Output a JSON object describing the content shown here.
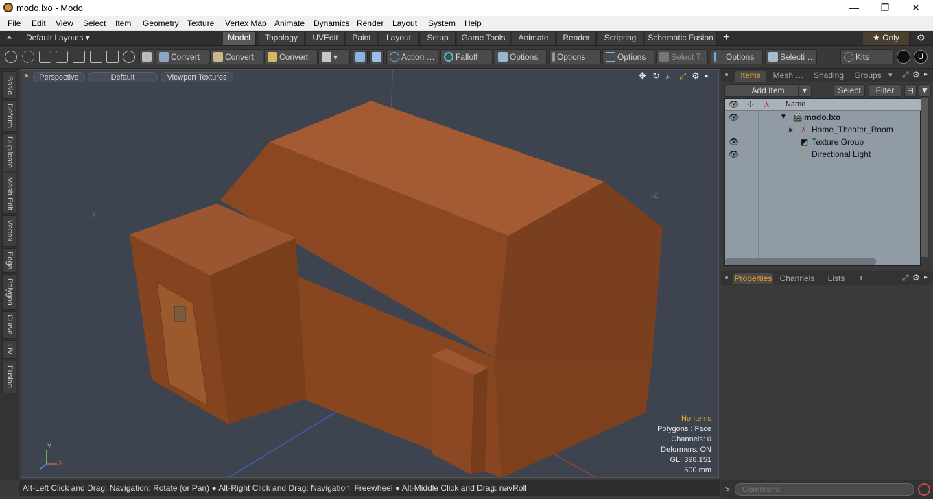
{
  "window": {
    "title": "modo.lxo - Modo",
    "minimize": "—",
    "maximize": "❐",
    "close": "✕"
  },
  "menu": [
    "File",
    "Edit",
    "View",
    "Select",
    "Item",
    "Geometry",
    "Texture",
    "Vertex Map",
    "Animate",
    "Dynamics",
    "Render",
    "Layout",
    "System",
    "Help"
  ],
  "layouts": {
    "label": "Default Layouts ▾"
  },
  "tabs": [
    "Model",
    "Topology",
    "UVEdit",
    "Paint",
    "Layout",
    "Setup",
    "Game Tools",
    "Animate",
    "Render",
    "Scripting",
    "Schematic Fusion"
  ],
  "tabs_extra": {
    "add": "+",
    "only": "★  Only",
    "gear": "⚙"
  },
  "toolbar": {
    "convert1": "Convert",
    "convert2": "Convert",
    "convert3": "Convert",
    "action": "Action  …",
    "falloff": "Falloff",
    "options1": "Options",
    "options2": "Options",
    "options3": "Options",
    "select_t": "Select T…",
    "options4": "Options",
    "selecti": "Selecti …",
    "kits": "Kits"
  },
  "left_tabs": [
    "Basic",
    "Deform",
    "Duplicate",
    "Mesh Edit",
    "Vertex",
    "Edge",
    "Polygon",
    "Curve",
    "UV",
    "Fusion"
  ],
  "viewport": {
    "perspective": "Perspective",
    "default": "Default",
    "textures": "Viewport Textures",
    "axis_x": "X",
    "axis_z": "-Z",
    "axis_y": "Y",
    "axis_x2": "X",
    "stats": {
      "no_items": "No Items",
      "polygons": "Polygons : Face",
      "channels": "Channels: 0",
      "deformers": "Deformers: ON",
      "gl": "GL: 398,151",
      "size": "500 mm"
    }
  },
  "status": "Alt-Left Click and Drag: Navigation: Rotate (or Pan) ● Alt-Right Click and Drag: Navigation: Freewheel ● Alt-Middle Click and Drag: navRoll",
  "items_panel": {
    "tabs": [
      "Items",
      "Mesh …",
      "Shading",
      "Groups"
    ],
    "add_item": "Add Item",
    "select": "Select",
    "filter": "Filter",
    "col_name": "Name",
    "rows": [
      {
        "name": "modo.lxo"
      },
      {
        "name": "Home_Theater_Room"
      },
      {
        "name": "Texture Group"
      },
      {
        "name": "Directional Light"
      }
    ]
  },
  "props_panel": {
    "tabs": [
      "Properties",
      "Channels",
      "Lists"
    ],
    "add": "+"
  },
  "command": {
    "placeholder": "Command",
    "prompt": ">"
  },
  "colors": {
    "accent": "#f0a020",
    "viewport_bg": "#3d4450",
    "house": "#8b4a22"
  }
}
